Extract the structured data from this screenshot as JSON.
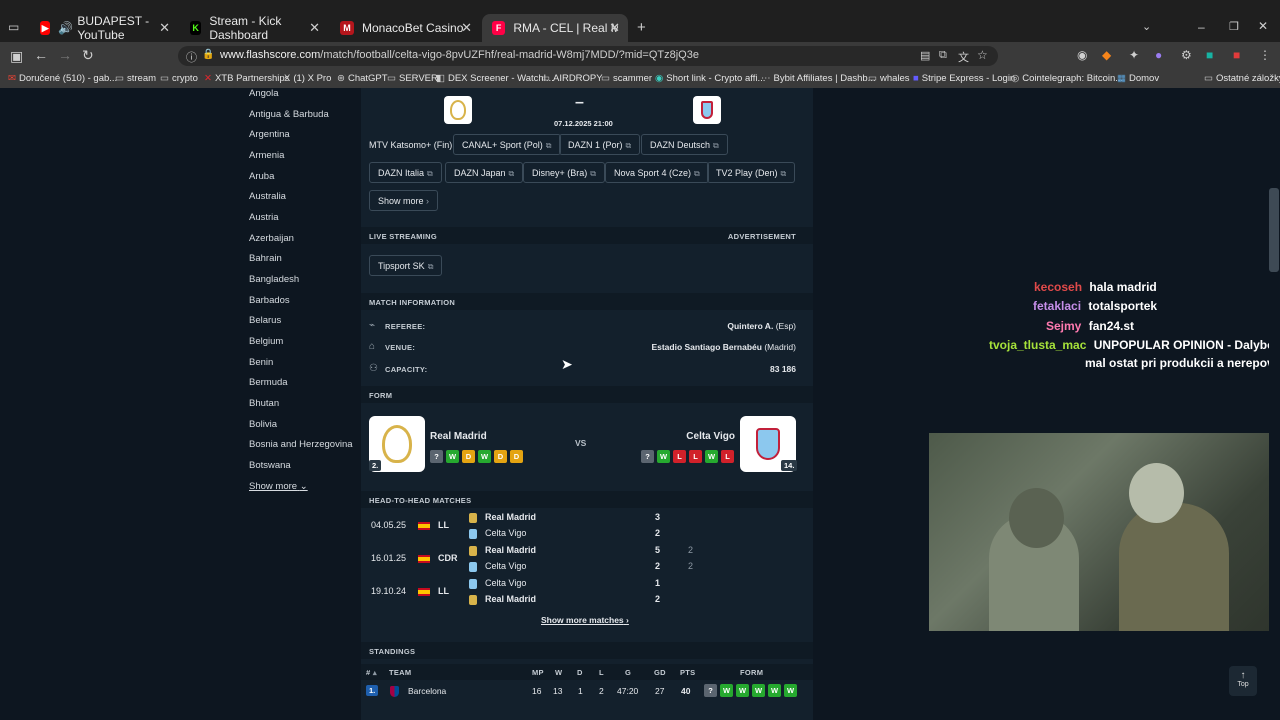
{
  "browser": {
    "tabs": [
      {
        "title": "BUDAPEST - YouTube",
        "fav": "▶",
        "color": "#ff0000"
      },
      {
        "title": "Stream - Kick Dashboard",
        "fav": "K",
        "color": "#53fc18"
      },
      {
        "title": "MonacoBet Casino",
        "fav": "M",
        "color": "#b5161c"
      },
      {
        "title": "RMA - CEL | Real Madrid v Celta",
        "fav": "F",
        "color": "#ff0046"
      }
    ],
    "url_host": "www.flashscore.com",
    "url_path": "/match/football/celta-vigo-8pvUZFhf/real-madrid-W8mj7MDD/?mid=QTz8jQ3e",
    "bookmarks": [
      "Doručené (510) - gab...",
      "stream",
      "crypto",
      "XTB Partnerships",
      "(1) X Pro",
      "ChatGPT",
      "SERVER",
      "DEX Screener - Watchl...",
      "AIRDROPY",
      "scammer",
      "Short link - Crypto affi...",
      "Bybit Affiliates | Dashb...",
      "whales",
      "Stripe Express - Login",
      "Cointelegraph: Bitcoin...",
      "Domov",
      "Ostatné záložky"
    ]
  },
  "sidebar": {
    "countries": [
      "Angola",
      "Antigua & Barbuda",
      "Argentina",
      "Armenia",
      "Aruba",
      "Australia",
      "Austria",
      "Azerbaijan",
      "Bahrain",
      "Bangladesh",
      "Barbados",
      "Belarus",
      "Belgium",
      "Benin",
      "Bermuda",
      "Bhutan",
      "Bolivia",
      "Bosnia and Herzegovina",
      "Botswana"
    ],
    "show_more": "Show more"
  },
  "match": {
    "score": "–",
    "datetime": "07.12.2025 21:00",
    "tv_first": "MTV Katsomo+ (Fin),",
    "tv_row1": [
      "CANAL+ Sport (Pol)",
      "DAZN 1 (Por)",
      "DAZN Deutsch"
    ],
    "tv_row2": [
      "DAZN Italia",
      "DAZN Japan",
      "Disney+ (Bra)",
      "Nova Sport 4 (Cze)",
      "TV2 Play (Den)"
    ],
    "show_more": "Show more",
    "live_streaming": "LIVE STREAMING",
    "advertisement": "ADVERTISEMENT",
    "streaming_link": "Tipsport SK",
    "info_title": "MATCH INFORMATION",
    "referee_label": "REFEREE:",
    "referee": "Quintero A.",
    "referee_country": "(Esp)",
    "venue_label": "VENUE:",
    "venue": "Estadio Santiago Bernabéu",
    "venue_city": "(Madrid)",
    "capacity_label": "CAPACITY:",
    "capacity": "83 186",
    "form_title": "FORM",
    "vs": "VS",
    "home": {
      "name": "Real Madrid",
      "rank": "2.",
      "form": [
        "?",
        "W",
        "D",
        "W",
        "D",
        "D"
      ]
    },
    "away": {
      "name": "Celta Vigo",
      "rank": "14.",
      "form": [
        "?",
        "W",
        "L",
        "L",
        "W",
        "L"
      ]
    },
    "h2h_title": "HEAD-TO-HEAD MATCHES",
    "h2h": [
      {
        "date": "04.05.25",
        "comp": "LL",
        "team1": "Real Madrid",
        "team2": "Celta Vigo",
        "s1": "3",
        "s2": "2",
        "p1": "",
        "p2": ""
      },
      {
        "date": "16.01.25",
        "comp": "CDR",
        "team1": "Real Madrid",
        "team2": "Celta Vigo",
        "s1": "5",
        "s2": "2",
        "p1": "2",
        "p2": "2"
      },
      {
        "date": "19.10.24",
        "comp": "LL",
        "team1": "Celta Vigo",
        "team2": "Real Madrid",
        "s1": "1",
        "s2": "2",
        "p1": "",
        "p2": ""
      }
    ],
    "show_more_matches": "Show more matches",
    "standings_title": "STANDINGS",
    "standings_headers": [
      "#",
      "TEAM",
      "MP",
      "W",
      "D",
      "L",
      "G",
      "GD",
      "PTS",
      "FORM"
    ],
    "standings": [
      {
        "pos": "1.",
        "team": "Barcelona",
        "mp": "16",
        "w": "13",
        "d": "1",
        "l": "2",
        "g": "47:20",
        "gd": "27",
        "pts": "40",
        "form": [
          "?",
          "W",
          "W",
          "W",
          "W",
          "W"
        ]
      }
    ]
  },
  "chat": [
    {
      "user": "kecoseh",
      "msg": "hala madrid",
      "color": "#e04a4a"
    },
    {
      "user": "fetaklaci",
      "msg": "totalsportek",
      "color": "#c58ee8"
    },
    {
      "user": "Sejmy",
      "msg": "fan24.st",
      "color": "#ff7ab0"
    },
    {
      "user": "tvoja_tlusta_mac",
      "msg": "UNPOPULAR OPINION - Dalybor",
      "msg2": "mal ostat pri produkcii a nerepovať",
      "color": "#a6e23a"
    }
  ],
  "top_button": "Top"
}
